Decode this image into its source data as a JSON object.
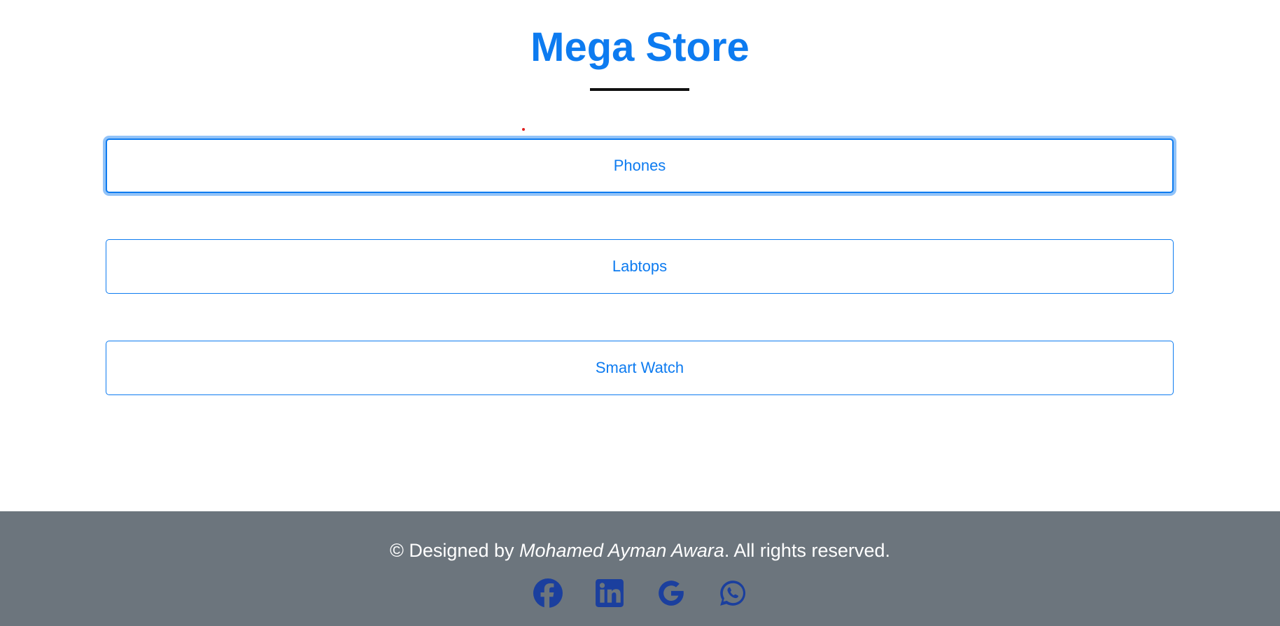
{
  "header": {
    "title": "Mega Store"
  },
  "categories": [
    {
      "label": "Phones",
      "focused": true
    },
    {
      "label": "Labtops",
      "focused": false
    },
    {
      "label": "Smart Watch",
      "focused": false
    }
  ],
  "footer": {
    "copyright_prefix": "© Designed by ",
    "author": "Mohamed Ayman Awara",
    "copyright_suffix": ". All rights reserved.",
    "social_icons": [
      "facebook-icon",
      "linkedin-icon",
      "google-icon",
      "whatsapp-icon"
    ]
  },
  "colors": {
    "accent": "#0d7bf0",
    "footer_bg": "#6c757d",
    "social_icon": "#1b3f9e"
  }
}
